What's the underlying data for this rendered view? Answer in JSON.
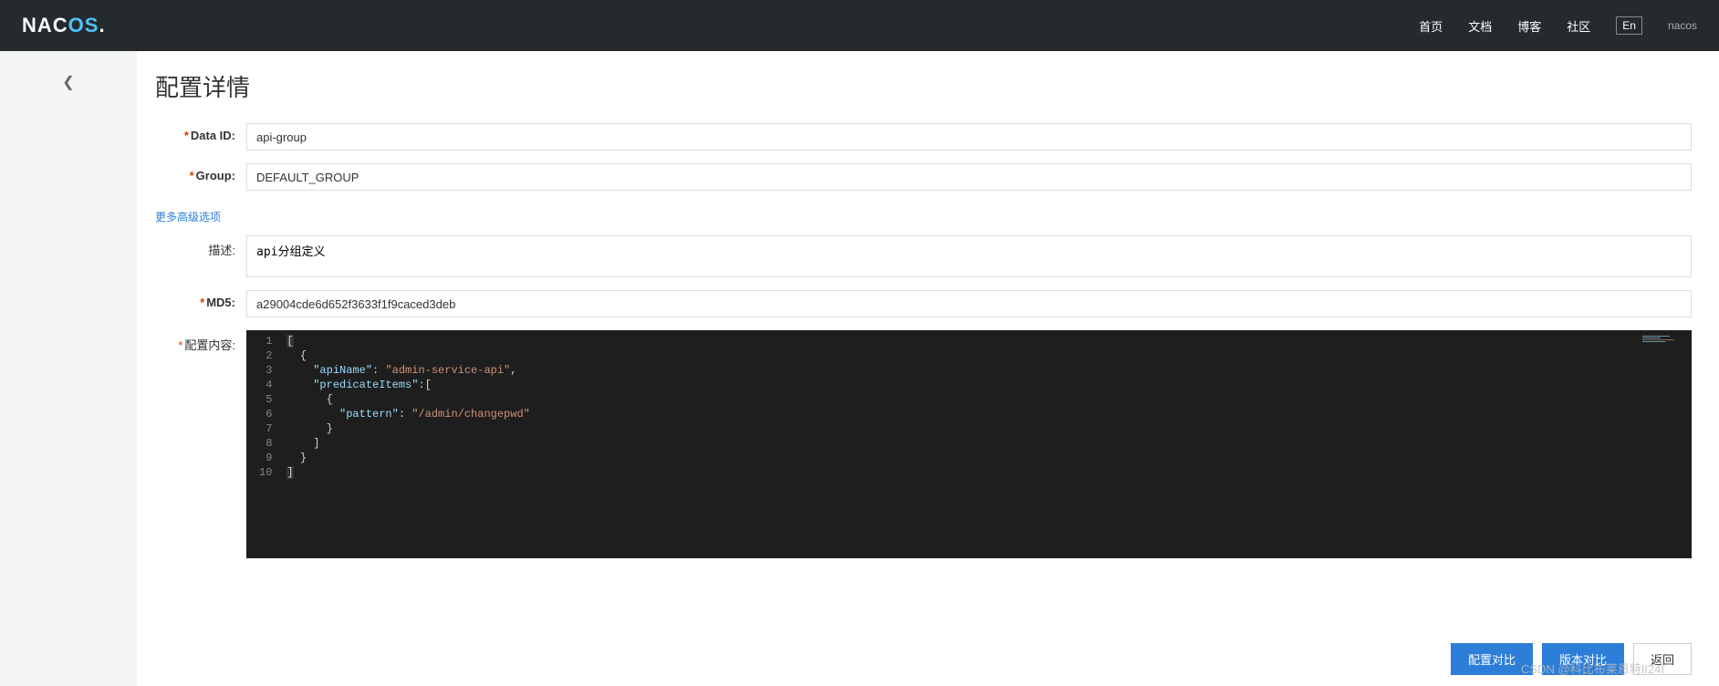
{
  "header": {
    "logo_part1": "NAC",
    "logo_part2": "OS",
    "logo_dot": ".",
    "nav": {
      "home": "首页",
      "docs": "文档",
      "blog": "博客",
      "community": "社区"
    },
    "lang": "En",
    "right_link": "nacos"
  },
  "page": {
    "title": "配置详情",
    "advanced_options": "更多高级选项"
  },
  "form": {
    "data_id": {
      "label": "Data ID:",
      "value": "api-group"
    },
    "group": {
      "label": "Group:",
      "value": "DEFAULT_GROUP"
    },
    "desc": {
      "label": "描述:",
      "value": "api分组定义"
    },
    "md5": {
      "label": "MD5:",
      "value": "a29004cde6d652f3633f1f9caced3deb"
    },
    "content": {
      "label": "配置内容:"
    }
  },
  "code": {
    "line_numbers": [
      "1",
      "2",
      "3",
      "4",
      "5",
      "6",
      "7",
      "8",
      "9",
      "10"
    ],
    "tokens": [
      [
        {
          "t": "brace",
          "v": "["
        }
      ],
      [
        {
          "t": "indent",
          "v": "  "
        },
        {
          "t": "brace",
          "v": "{"
        }
      ],
      [
        {
          "t": "indent",
          "v": "    "
        },
        {
          "t": "key",
          "v": "\"apiName\""
        },
        {
          "t": "punc",
          "v": ": "
        },
        {
          "t": "str",
          "v": "\"admin-service-api\""
        },
        {
          "t": "punc",
          "v": ","
        }
      ],
      [
        {
          "t": "indent",
          "v": "    "
        },
        {
          "t": "key",
          "v": "\"predicateItems\""
        },
        {
          "t": "punc",
          "v": ":["
        }
      ],
      [
        {
          "t": "indent",
          "v": "      "
        },
        {
          "t": "brace",
          "v": "{"
        }
      ],
      [
        {
          "t": "indent",
          "v": "        "
        },
        {
          "t": "key",
          "v": "\"pattern\""
        },
        {
          "t": "punc",
          "v": ": "
        },
        {
          "t": "str",
          "v": "\"/admin/changepwd\""
        }
      ],
      [
        {
          "t": "indent",
          "v": "      "
        },
        {
          "t": "brace",
          "v": "}"
        }
      ],
      [
        {
          "t": "indent",
          "v": "    "
        },
        {
          "t": "punc",
          "v": "]"
        }
      ],
      [
        {
          "t": "indent",
          "v": "  "
        },
        {
          "t": "brace",
          "v": "}"
        }
      ],
      [
        {
          "t": "brace",
          "v": "]"
        }
      ]
    ]
  },
  "footer": {
    "config_compare": "配置对比",
    "version_compare": "版本对比",
    "back": "返回"
  },
  "watermark": "CSDN @科比布莱恩特II24I"
}
